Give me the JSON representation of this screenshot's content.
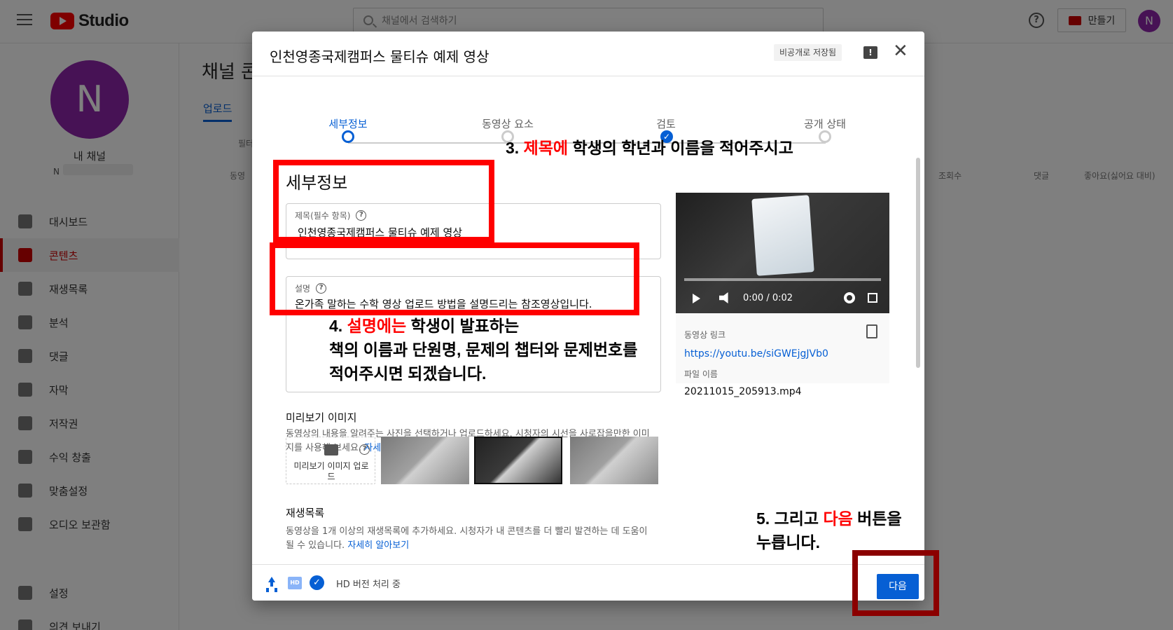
{
  "app": {
    "logo_text": "Studio",
    "search_placeholder": "채널에서 검색하기",
    "create_label": "만들기",
    "avatar_letter": "N"
  },
  "sidebar": {
    "avatar_letter": "N",
    "channel_title": "내 채널",
    "channel_sub": "N",
    "items": [
      {
        "label": "대시보드",
        "icon": "dashboard-icon"
      },
      {
        "label": "콘텐츠",
        "icon": "content-icon",
        "active": true
      },
      {
        "label": "재생목록",
        "icon": "playlist-icon"
      },
      {
        "label": "분석",
        "icon": "analytics-icon"
      },
      {
        "label": "댓글",
        "icon": "comments-icon"
      },
      {
        "label": "자막",
        "icon": "subtitles-icon"
      },
      {
        "label": "저작권",
        "icon": "copyright-icon"
      },
      {
        "label": "수익 창출",
        "icon": "dollar-icon"
      },
      {
        "label": "맞춤설정",
        "icon": "wand-icon"
      },
      {
        "label": "오디오 보관함",
        "icon": "audio-library-icon"
      },
      {
        "label": "설정",
        "icon": "gear-icon"
      },
      {
        "label": "의견 보내기",
        "icon": "feedback-icon"
      }
    ]
  },
  "page": {
    "title": "채널 콘",
    "tab": "업로드",
    "filter": "필터",
    "headers": {
      "video": "동영",
      "views": "조회수",
      "comments": "댓글",
      "likes": "좋아요(싫어요 대비)"
    }
  },
  "modal": {
    "title": "인천영종국제캠퍼스 물티슈 예제 영상",
    "saved_badge": "비공개로 저장됨",
    "steps": [
      "세부정보",
      "동영상 요소",
      "검토",
      "공개 상태"
    ],
    "section_heading": "세부정보",
    "title_field": {
      "label": "제목(필수 항목)",
      "value": "인천영종국제캠퍼스 물티슈 예제 영상"
    },
    "description_field": {
      "label": "설명",
      "value": "온가족 말하는 수학 영상 업로드 방법을 설명드리는 참조영상입니다."
    },
    "thumbnail": {
      "heading": "미리보기 이미지",
      "helper": "동영상의 내용을 알려주는 사진을 선택하거나 업로드하세요. 시청자의 시선을 사로잡을만한 이미지를 사용해 보세요.",
      "learn_more": "자세히 알아보기",
      "upload_label": "미리보기 이미지 업로드"
    },
    "playlist": {
      "heading": "재생목록",
      "helper": "동영상을 1개 이상의 재생목록에 추가하세요. 시청자가 내 콘텐츠를 더 빨리 발견하는 데 도움이 될 수 있습니다.",
      "learn_more": "자세히 알아보기"
    },
    "preview": {
      "time": "0:00 / 0:02",
      "link_label": "동영상 링크",
      "link": "https://youtu.be/siGWEjgJVb0",
      "file_label": "파일 이름",
      "file": "20211015_205913.mp4"
    },
    "footer": {
      "hd_badge": "HD",
      "status": "HD 버전 처리 중",
      "next_label": "다음"
    }
  },
  "annotations": {
    "a3": {
      "prefix": "3. ",
      "highlight": "제목에",
      "rest": " 학생의 학년과 이름을 적어주시고"
    },
    "a4": {
      "prefix": "4. ",
      "highlight": "설명에는",
      "rest": " 학생이 발표하는",
      "line2": "책의 이름과 단원명, 문제의 챕터와 문제번호를",
      "line3": "적어주시면 되겠습니다."
    },
    "a5": {
      "prefix": "5. 그리고 ",
      "highlight": "다음",
      "rest": " 버튼을",
      "line2": "누릅니다."
    }
  }
}
